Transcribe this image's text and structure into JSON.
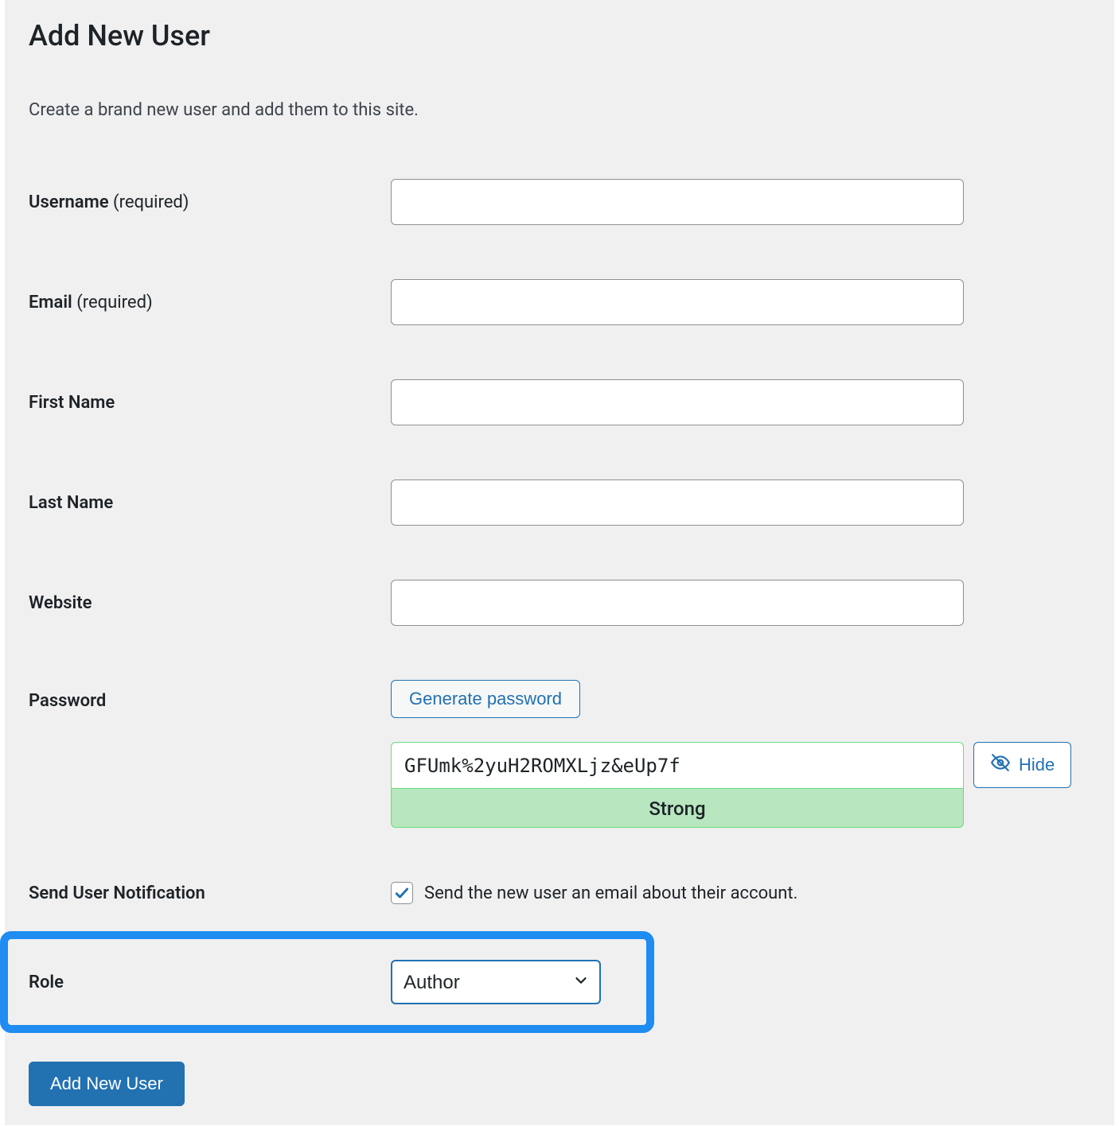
{
  "page": {
    "title": "Add New User",
    "description": "Create a brand new user and add them to this site."
  },
  "fields": {
    "username": {
      "label": "Username",
      "required_suffix": " (required)",
      "value": ""
    },
    "email": {
      "label": "Email",
      "required_suffix": " (required)",
      "value": ""
    },
    "first_name": {
      "label": "First Name",
      "value": ""
    },
    "last_name": {
      "label": "Last Name",
      "value": ""
    },
    "website": {
      "label": "Website",
      "value": ""
    },
    "password": {
      "label": "Password",
      "generate_button": "Generate password",
      "value": "GFUmk%2yuH2ROMXLjz&eUp7f",
      "strength": "Strong",
      "hide_button": "Hide"
    },
    "notification": {
      "label": "Send User Notification",
      "checkbox_checked": true,
      "description": "Send the new user an email about their account."
    },
    "role": {
      "label": "Role",
      "selected": "Author"
    }
  },
  "submit": {
    "label": "Add New User"
  },
  "colors": {
    "accent": "#2271b1",
    "highlight_border": "#1e8cf0",
    "strength_bg": "#b8e6bf",
    "strength_border": "#68de7c"
  }
}
